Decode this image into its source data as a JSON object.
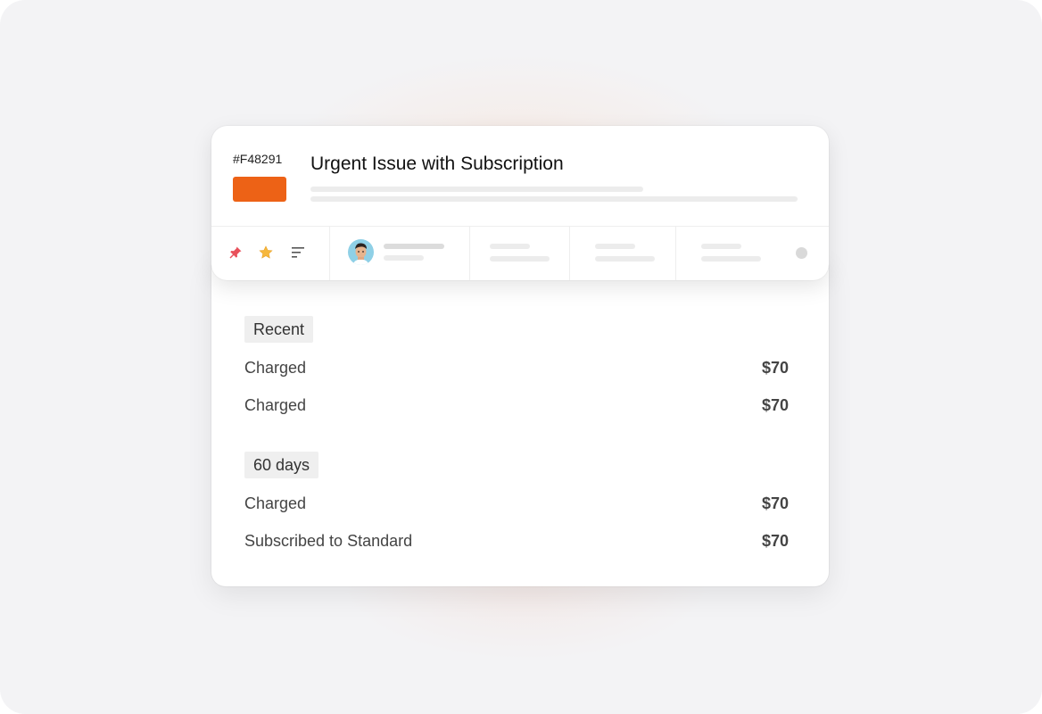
{
  "ticket": {
    "id": "#F48291",
    "title": "Urgent Issue with Subscription",
    "status_color": "#ED6216"
  },
  "toolbar": {
    "icons": [
      "pin-icon",
      "star-icon",
      "sort-lines-icon"
    ],
    "colors": {
      "pin": "#E8505B",
      "star": "#F6B73C"
    }
  },
  "history": {
    "recent": {
      "label": "Recent",
      "items": [
        {
          "label": "Charged",
          "amount": "$70"
        },
        {
          "label": "Charged",
          "amount": "$70"
        }
      ]
    },
    "sixty_days": {
      "label": "60 days",
      "items": [
        {
          "label": "Charged",
          "amount": "$70"
        },
        {
          "label": "Subscribed to Standard",
          "amount": "$70"
        }
      ]
    }
  }
}
